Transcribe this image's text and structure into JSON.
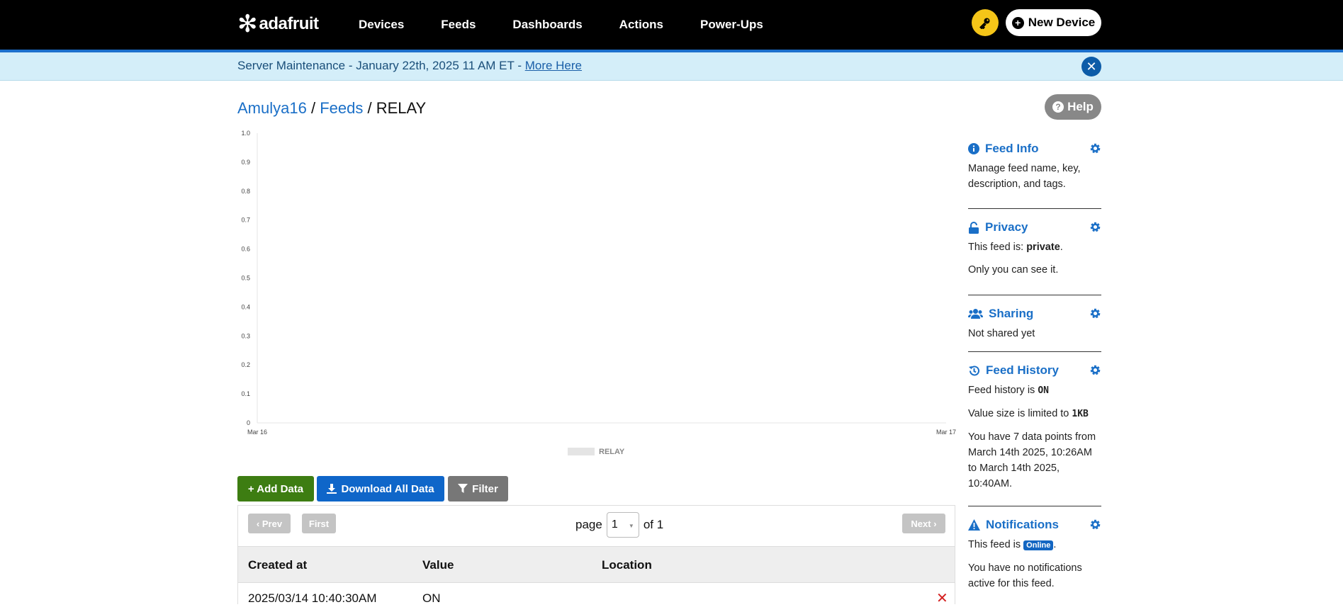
{
  "header": {
    "logo_text": "adafruit",
    "nav": [
      "Devices",
      "Feeds",
      "Dashboards",
      "Actions",
      "Power-Ups"
    ],
    "new_device_label": "New Device",
    "colors": {
      "bar": "#000000",
      "accent": "#1c6fcc",
      "key": "#f5c518"
    }
  },
  "banner": {
    "text": "Server Maintenance - January 22th, 2025 11 AM ET - ",
    "link": "More Here"
  },
  "breadcrumb": {
    "user": "Amulya16",
    "sep1": " / ",
    "feeds": "Feeds",
    "sep2": " / ",
    "feed": "RELAY"
  },
  "help_label": "Help",
  "chart_data": {
    "type": "line",
    "x_ticks": [
      "Mar 16",
      "Mar 17"
    ],
    "y_ticks": [
      "1.0",
      "0.9",
      "0.8",
      "0.7",
      "0.6",
      "0.5",
      "0.4",
      "0.3",
      "0.2",
      "0.1",
      "0"
    ],
    "ylim": [
      0,
      1
    ],
    "series": [
      {
        "name": "RELAY",
        "values": []
      }
    ],
    "legend_placement": "bottom-center",
    "grid": false
  },
  "actions": {
    "add_data": "+ Add Data",
    "download": "Download All Data",
    "filter": "Filter"
  },
  "pager": {
    "prev": "Prev",
    "first": "First",
    "next": "Next",
    "page_label": "page",
    "current": "1",
    "of_label": "of 1"
  },
  "table": {
    "columns": [
      "Created at",
      "Value",
      "Location"
    ],
    "rows": [
      {
        "created": "2025/03/14 10:40:30AM",
        "value": "ON",
        "location": ""
      }
    ]
  },
  "sidebar": {
    "feed_info": {
      "title": "Feed Info",
      "text": "Manage feed name, key, description, and tags."
    },
    "privacy": {
      "title": "Privacy",
      "text_prefix": "This feed is: ",
      "status": "private",
      "text_suffix": ".",
      "text2": "Only you can see it."
    },
    "sharing": {
      "title": "Sharing",
      "text": "Not shared yet"
    },
    "history": {
      "title": "Feed History",
      "text_prefix": "Feed history is ",
      "status": "ON",
      "limit_prefix": "Value size is limited to ",
      "limit": "1KB",
      "points_text": "You have 7 data points from March 14th 2025, 10:26AM to March 14th 2025, 10:40AM."
    },
    "notifications": {
      "title": "Notifications",
      "text_prefix": "This feed is ",
      "status": "Online",
      "text_suffix": ".",
      "text2": "You have no notifications active for this feed."
    }
  }
}
